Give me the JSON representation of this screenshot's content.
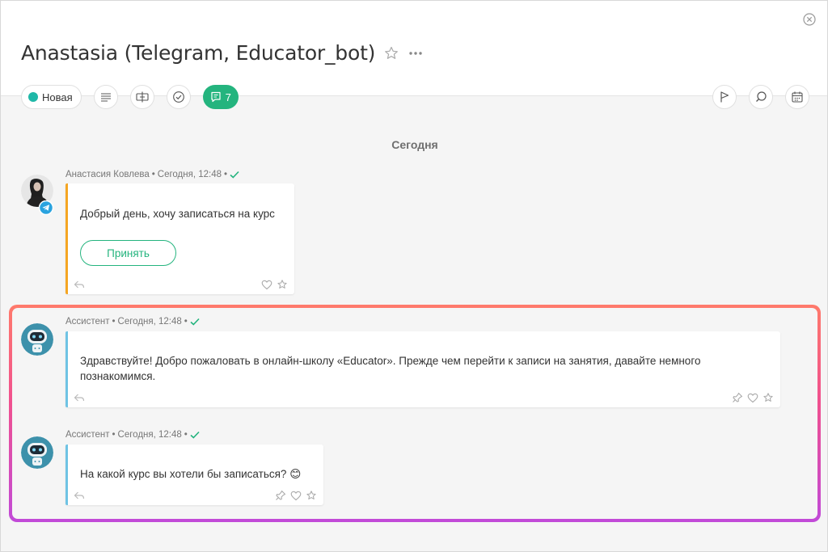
{
  "header": {
    "title": "Anastasia (Telegram, Educator_bot)",
    "status_label": "Новая",
    "status_color": "#1fb8a8",
    "messages_count": "7",
    "accent_color": "#24b47e"
  },
  "icons": {
    "close": "close-icon",
    "star": "star-icon",
    "more": "more-icon",
    "toolbar_left": [
      "list-icon",
      "pin-board-icon",
      "check-circle-icon"
    ],
    "messages": "message-icon",
    "toolbar_right": [
      "flag-icon",
      "search-icon",
      "calendar-icon"
    ]
  },
  "feed": {
    "day_label": "Сегодня",
    "messages": [
      {
        "author": "Анастасия Ковлева",
        "time": "Сегодня, 12:48",
        "text": "Добрый день, хочу записаться на курс",
        "button": "Принять",
        "bar_color": "#f5a623"
      },
      {
        "author": "Ассистент",
        "time": "Сегодня, 12:48",
        "text": "Здравствуйте! Добро пожаловать в онлайн-школу «Educator». Прежде чем перейти к записи на занятия, давайте немного познакомимся.",
        "bar_color": "#6fc3e4"
      },
      {
        "author": "Ассистент",
        "time": "Сегодня, 12:48",
        "text": "На какой курс вы хотели бы записаться?",
        "emoji": "😊",
        "bar_color": "#6fc3e4"
      }
    ]
  }
}
